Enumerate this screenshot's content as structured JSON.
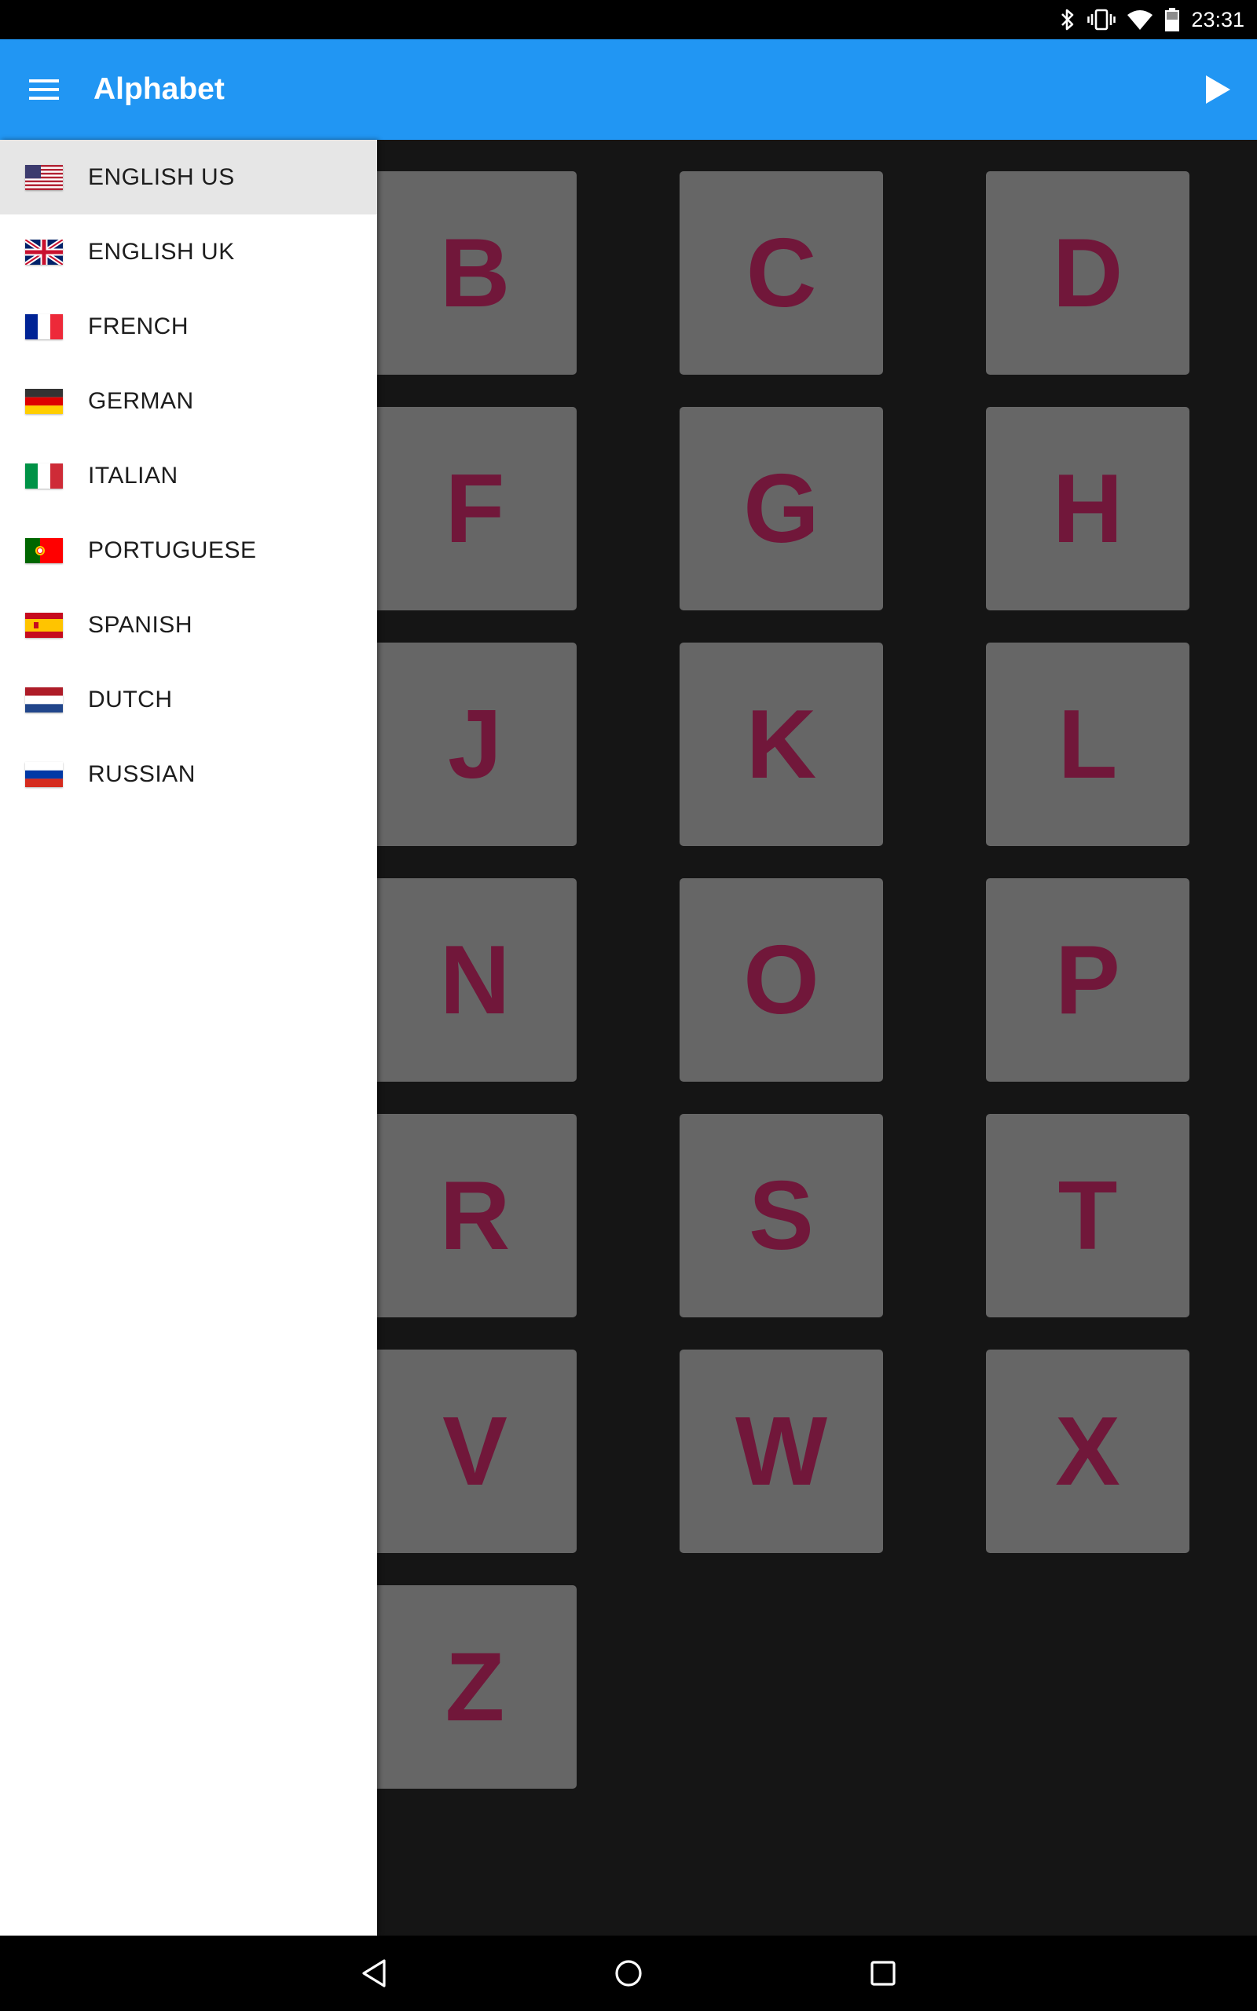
{
  "status_bar": {
    "time": "23:31",
    "icons": [
      "bluetooth-icon",
      "vibrate-icon",
      "wifi-icon",
      "battery-icon"
    ]
  },
  "app_bar": {
    "title": "Alphabet",
    "menu_icon": "hamburger-menu-icon",
    "play_icon": "play-icon",
    "color": "#2196f3"
  },
  "drawer": {
    "items": [
      {
        "label": "ENGLISH US",
        "flag": "us-flag-icon",
        "selected": true
      },
      {
        "label": "ENGLISH UK",
        "flag": "uk-flag-icon",
        "selected": false
      },
      {
        "label": "FRENCH",
        "flag": "france-flag-icon",
        "selected": false
      },
      {
        "label": "GERMAN",
        "flag": "germany-flag-icon",
        "selected": false
      },
      {
        "label": "ITALIAN",
        "flag": "italy-flag-icon",
        "selected": false
      },
      {
        "label": "PORTUGUESE",
        "flag": "portugal-flag-icon",
        "selected": false
      },
      {
        "label": "SPANISH",
        "flag": "spain-flag-icon",
        "selected": false
      },
      {
        "label": "DUTCH",
        "flag": "netherlands-flag-icon",
        "selected": false
      },
      {
        "label": "RUSSIAN",
        "flag": "russia-flag-icon",
        "selected": false
      }
    ]
  },
  "grid": {
    "tile_color": "#666666",
    "letter_color": "#71173a",
    "rows": [
      [
        "B",
        "C",
        "D"
      ],
      [
        "F",
        "G",
        "H"
      ],
      [
        "J",
        "K",
        "L"
      ],
      [
        "N",
        "O",
        "P"
      ],
      [
        "R",
        "S",
        "T"
      ],
      [
        "V",
        "W",
        "X"
      ],
      [
        "Z"
      ]
    ]
  },
  "nav_bar": {
    "icons": [
      "back-icon",
      "home-icon",
      "recents-icon"
    ]
  }
}
